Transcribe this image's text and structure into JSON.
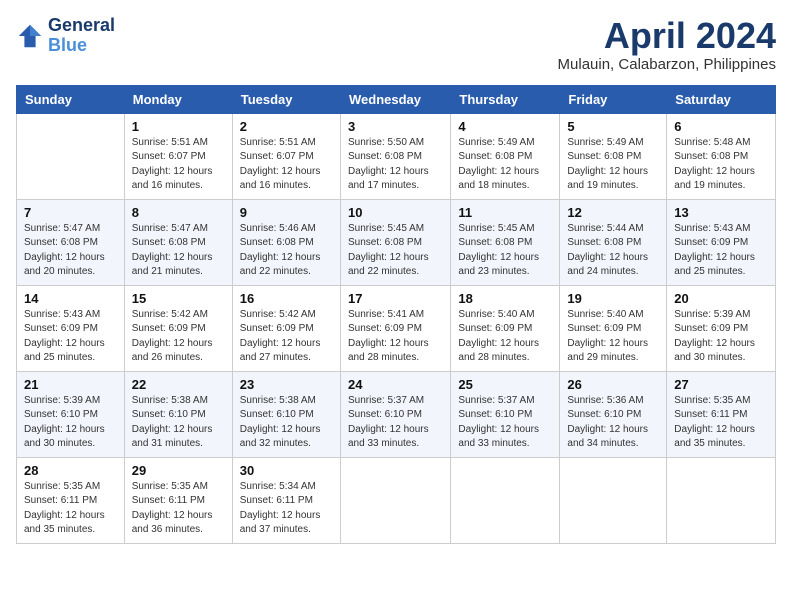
{
  "header": {
    "logo_line1": "General",
    "logo_line2": "Blue",
    "month": "April 2024",
    "location": "Mulauin, Calabarzon, Philippines"
  },
  "days_of_week": [
    "Sunday",
    "Monday",
    "Tuesday",
    "Wednesday",
    "Thursday",
    "Friday",
    "Saturday"
  ],
  "weeks": [
    [
      {
        "num": "",
        "info": ""
      },
      {
        "num": "1",
        "info": "Sunrise: 5:51 AM\nSunset: 6:07 PM\nDaylight: 12 hours\nand 16 minutes."
      },
      {
        "num": "2",
        "info": "Sunrise: 5:51 AM\nSunset: 6:07 PM\nDaylight: 12 hours\nand 16 minutes."
      },
      {
        "num": "3",
        "info": "Sunrise: 5:50 AM\nSunset: 6:08 PM\nDaylight: 12 hours\nand 17 minutes."
      },
      {
        "num": "4",
        "info": "Sunrise: 5:49 AM\nSunset: 6:08 PM\nDaylight: 12 hours\nand 18 minutes."
      },
      {
        "num": "5",
        "info": "Sunrise: 5:49 AM\nSunset: 6:08 PM\nDaylight: 12 hours\nand 19 minutes."
      },
      {
        "num": "6",
        "info": "Sunrise: 5:48 AM\nSunset: 6:08 PM\nDaylight: 12 hours\nand 19 minutes."
      }
    ],
    [
      {
        "num": "7",
        "info": "Sunrise: 5:47 AM\nSunset: 6:08 PM\nDaylight: 12 hours\nand 20 minutes."
      },
      {
        "num": "8",
        "info": "Sunrise: 5:47 AM\nSunset: 6:08 PM\nDaylight: 12 hours\nand 21 minutes."
      },
      {
        "num": "9",
        "info": "Sunrise: 5:46 AM\nSunset: 6:08 PM\nDaylight: 12 hours\nand 22 minutes."
      },
      {
        "num": "10",
        "info": "Sunrise: 5:45 AM\nSunset: 6:08 PM\nDaylight: 12 hours\nand 22 minutes."
      },
      {
        "num": "11",
        "info": "Sunrise: 5:45 AM\nSunset: 6:08 PM\nDaylight: 12 hours\nand 23 minutes."
      },
      {
        "num": "12",
        "info": "Sunrise: 5:44 AM\nSunset: 6:08 PM\nDaylight: 12 hours\nand 24 minutes."
      },
      {
        "num": "13",
        "info": "Sunrise: 5:43 AM\nSunset: 6:09 PM\nDaylight: 12 hours\nand 25 minutes."
      }
    ],
    [
      {
        "num": "14",
        "info": "Sunrise: 5:43 AM\nSunset: 6:09 PM\nDaylight: 12 hours\nand 25 minutes."
      },
      {
        "num": "15",
        "info": "Sunrise: 5:42 AM\nSunset: 6:09 PM\nDaylight: 12 hours\nand 26 minutes."
      },
      {
        "num": "16",
        "info": "Sunrise: 5:42 AM\nSunset: 6:09 PM\nDaylight: 12 hours\nand 27 minutes."
      },
      {
        "num": "17",
        "info": "Sunrise: 5:41 AM\nSunset: 6:09 PM\nDaylight: 12 hours\nand 28 minutes."
      },
      {
        "num": "18",
        "info": "Sunrise: 5:40 AM\nSunset: 6:09 PM\nDaylight: 12 hours\nand 28 minutes."
      },
      {
        "num": "19",
        "info": "Sunrise: 5:40 AM\nSunset: 6:09 PM\nDaylight: 12 hours\nand 29 minutes."
      },
      {
        "num": "20",
        "info": "Sunrise: 5:39 AM\nSunset: 6:09 PM\nDaylight: 12 hours\nand 30 minutes."
      }
    ],
    [
      {
        "num": "21",
        "info": "Sunrise: 5:39 AM\nSunset: 6:10 PM\nDaylight: 12 hours\nand 30 minutes."
      },
      {
        "num": "22",
        "info": "Sunrise: 5:38 AM\nSunset: 6:10 PM\nDaylight: 12 hours\nand 31 minutes."
      },
      {
        "num": "23",
        "info": "Sunrise: 5:38 AM\nSunset: 6:10 PM\nDaylight: 12 hours\nand 32 minutes."
      },
      {
        "num": "24",
        "info": "Sunrise: 5:37 AM\nSunset: 6:10 PM\nDaylight: 12 hours\nand 33 minutes."
      },
      {
        "num": "25",
        "info": "Sunrise: 5:37 AM\nSunset: 6:10 PM\nDaylight: 12 hours\nand 33 minutes."
      },
      {
        "num": "26",
        "info": "Sunrise: 5:36 AM\nSunset: 6:10 PM\nDaylight: 12 hours\nand 34 minutes."
      },
      {
        "num": "27",
        "info": "Sunrise: 5:35 AM\nSunset: 6:11 PM\nDaylight: 12 hours\nand 35 minutes."
      }
    ],
    [
      {
        "num": "28",
        "info": "Sunrise: 5:35 AM\nSunset: 6:11 PM\nDaylight: 12 hours\nand 35 minutes."
      },
      {
        "num": "29",
        "info": "Sunrise: 5:35 AM\nSunset: 6:11 PM\nDaylight: 12 hours\nand 36 minutes."
      },
      {
        "num": "30",
        "info": "Sunrise: 5:34 AM\nSunset: 6:11 PM\nDaylight: 12 hours\nand 37 minutes."
      },
      {
        "num": "",
        "info": ""
      },
      {
        "num": "",
        "info": ""
      },
      {
        "num": "",
        "info": ""
      },
      {
        "num": "",
        "info": ""
      }
    ]
  ]
}
